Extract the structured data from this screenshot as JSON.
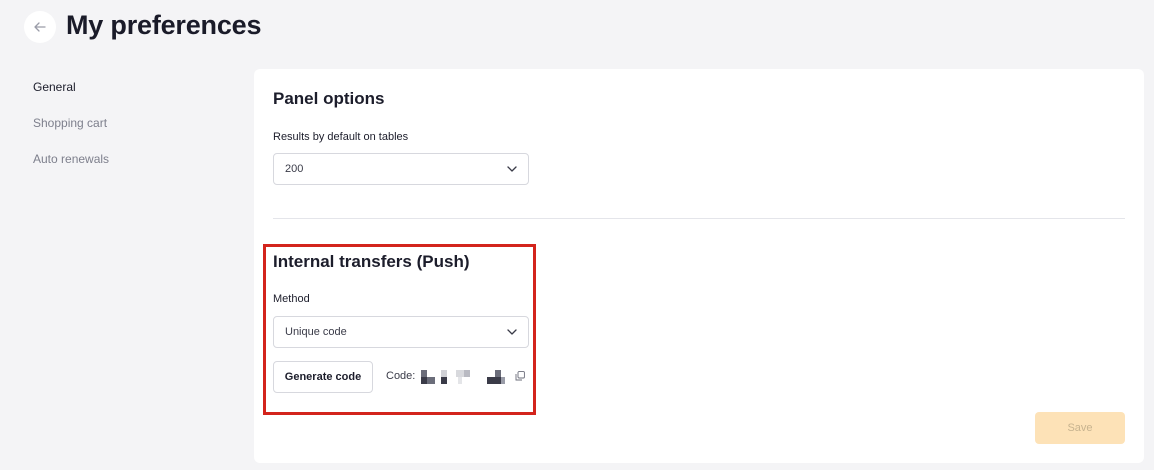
{
  "header": {
    "title": "My preferences",
    "back_icon": "arrow-left-icon"
  },
  "sidebar": {
    "items": [
      {
        "label": "General",
        "active": true
      },
      {
        "label": "Shopping cart",
        "active": false
      },
      {
        "label": "Auto renewals",
        "active": false
      }
    ]
  },
  "panel_options": {
    "title": "Panel options",
    "results_label": "Results by default on tables",
    "results_value": "200"
  },
  "internal_transfers": {
    "title": "Internal transfers (Push)",
    "method_label": "Method",
    "method_value": "Unique code",
    "generate_button": "Generate code",
    "code_label": "Code:",
    "highlight_color": "#d3241c"
  },
  "footer": {
    "save_label": "Save",
    "save_color": "#fde2b7"
  }
}
